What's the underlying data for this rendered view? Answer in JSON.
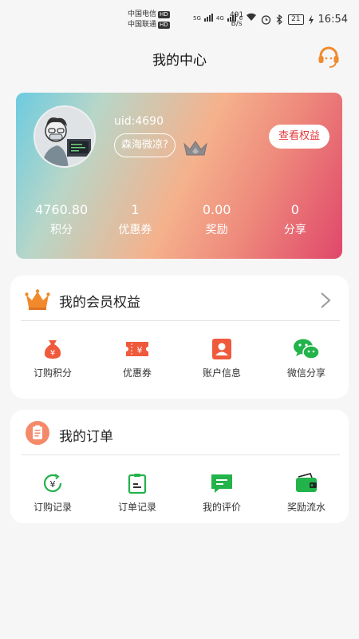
{
  "status_bar": {
    "carrier1": "中国电信",
    "carrier2": "中国联通",
    "hd": "HD",
    "net1": "5G",
    "net2": "4G",
    "net3": "6",
    "speed_value": "491",
    "speed_unit": "B/s",
    "battery": "21",
    "time": "16:54"
  },
  "header": {
    "title": "我的中心",
    "service_icon": "headset-icon"
  },
  "profile": {
    "uid": "uid:4690",
    "nickname": "森海微凉?",
    "view_rights_label": "查看权益",
    "stats": [
      {
        "value": "4760.80",
        "label": "积分"
      },
      {
        "value": "1",
        "label": "优惠券"
      },
      {
        "value": "0.00",
        "label": "奖励"
      },
      {
        "value": "0",
        "label": "分享"
      }
    ]
  },
  "membership": {
    "title": "我的会员权益",
    "items": [
      {
        "label": "订购积分",
        "icon": "money-bag-icon"
      },
      {
        "label": "优惠券",
        "icon": "ticket-icon"
      },
      {
        "label": "账户信息",
        "icon": "user-card-icon"
      },
      {
        "label": "微信分享",
        "icon": "wechat-icon"
      }
    ]
  },
  "orders": {
    "title": "我的订单",
    "items": [
      {
        "label": "订购记录",
        "icon": "yen-record-icon"
      },
      {
        "label": "订单记录",
        "icon": "clipboard-icon"
      },
      {
        "label": "我的评价",
        "icon": "comment-icon"
      },
      {
        "label": "奖励流水",
        "icon": "wallet-icon"
      }
    ]
  },
  "colors": {
    "accent_red": "#e23b3b",
    "orange": "#f08a2c",
    "green": "#22b34a",
    "background": "#f6f6f6"
  }
}
